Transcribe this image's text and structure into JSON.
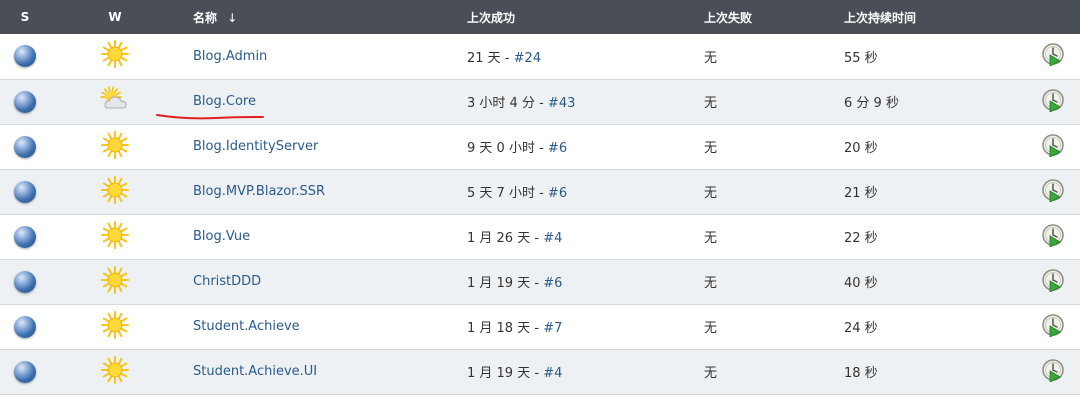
{
  "headers": {
    "s": "S",
    "w": "W",
    "name": "名称",
    "sort_arrow": "↓",
    "last_success": "上次成功",
    "last_failure": "上次失败",
    "last_duration": "上次持续时间"
  },
  "colors": {
    "header_bg": "#4a4f57",
    "link": "#2a5a8a",
    "row_alt_bg": "#eef1f4",
    "annotation_underline": "#e02020"
  },
  "icons": {
    "status": "blue-ball-icon",
    "weather_sunny": "sun-icon",
    "weather_cloudy": "partly-cloudy-icon",
    "schedule": "schedule-build-icon"
  },
  "jobs": [
    {
      "name": "Blog.Admin",
      "success_time": "21 天",
      "success_build": "#24",
      "failure": "无",
      "duration": "55 秒",
      "weather": "sunny"
    },
    {
      "name": "Blog.Core",
      "success_time": "3 小时 4 分",
      "success_build": "#43",
      "failure": "无",
      "duration": "6 分 9 秒",
      "weather": "cloudy"
    },
    {
      "name": "Blog.IdentityServer",
      "success_time": "9 天 0 小时",
      "success_build": "#6",
      "failure": "无",
      "duration": "20 秒",
      "weather": "sunny"
    },
    {
      "name": "Blog.MVP.Blazor.SSR",
      "success_time": "5 天 7 小时",
      "success_build": "#6",
      "failure": "无",
      "duration": "21 秒",
      "weather": "sunny"
    },
    {
      "name": "Blog.Vue",
      "success_time": "1 月 26 天",
      "success_build": "#4",
      "failure": "无",
      "duration": "22 秒",
      "weather": "sunny"
    },
    {
      "name": "ChristDDD",
      "success_time": "1 月 19 天",
      "success_build": "#6",
      "failure": "无",
      "duration": "40 秒",
      "weather": "sunny"
    },
    {
      "name": "Student.Achieve",
      "success_time": "1 月 18 天",
      "success_build": "#7",
      "failure": "无",
      "duration": "24 秒",
      "weather": "sunny"
    },
    {
      "name": "Student.Achieve.UI",
      "success_time": "1 月 19 天",
      "success_build": "#4",
      "failure": "无",
      "duration": "18 秒",
      "weather": "sunny"
    }
  ]
}
